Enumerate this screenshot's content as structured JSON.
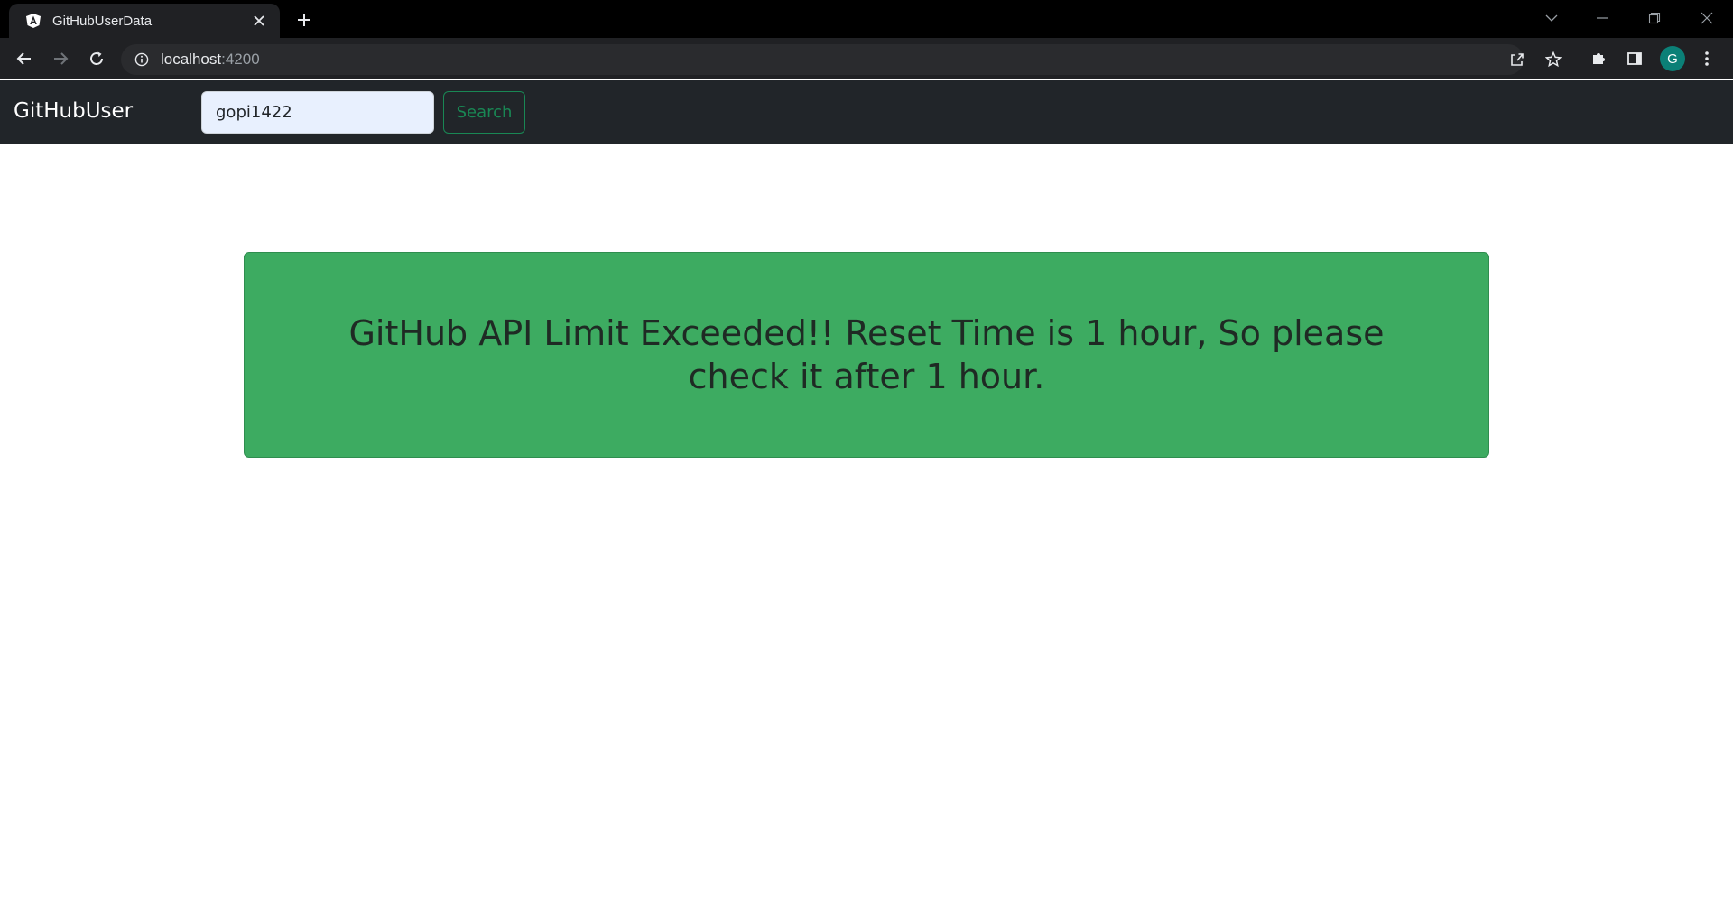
{
  "browser": {
    "tab_title": "GitHubUserData",
    "url_host": "localhost",
    "url_port": ":4200",
    "profile_initial": "G"
  },
  "navbar": {
    "brand": "GitHubUser",
    "search_value": "gopi1422",
    "search_button": "Search"
  },
  "alert": {
    "message": "GitHub API Limit Exceeded!! Reset Time is 1 hour, So please check it after 1 hour."
  },
  "colors": {
    "navbar_bg": "#212529",
    "alert_bg": "#3dab61",
    "search_button": "#198754",
    "input_bg": "#e8f0fe"
  }
}
